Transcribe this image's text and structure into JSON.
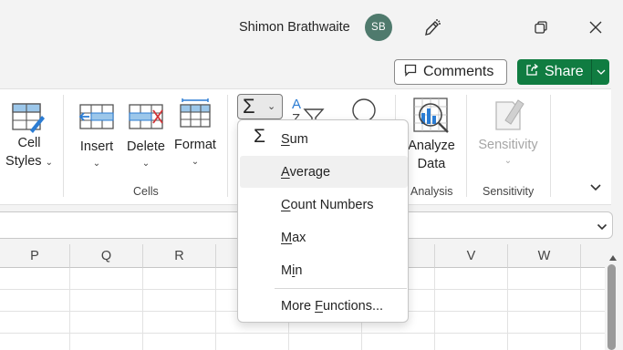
{
  "titlebar": {
    "user_name": "Shimon Brathwaite",
    "avatar_initials": "SB",
    "icons": [
      "designer-icon",
      "restore-window-icon",
      "close-window-icon"
    ]
  },
  "actions": {
    "comments_label": "Comments",
    "share_label": "Share"
  },
  "ribbon": {
    "cell_styles_line1": "Cell",
    "cell_styles_line2": "Styles",
    "insert_label": "Insert",
    "delete_label": "Delete",
    "format_label": "Format",
    "cells_group_label": "Cells",
    "analyze_line1": "Analyze",
    "analyze_line2": "Data",
    "analysis_group_label": "Analysis",
    "sensitivity_label": "Sensitivity",
    "sensitivity_group_label": "Sensitivity"
  },
  "autosum_menu": {
    "sum_prefix": "S",
    "sum_rest": "um",
    "average_prefix": "A",
    "average_rest": "verage",
    "count_prefix": "C",
    "count_rest": "ount Numbers",
    "max_prefix": "M",
    "max_rest": "ax",
    "min_a": "M",
    "min_b": "i",
    "min_c": "n",
    "more_a": "More ",
    "more_b": "F",
    "more_c": "unctions..."
  },
  "grid": {
    "columns": [
      "P",
      "Q",
      "R",
      "V",
      "W"
    ]
  },
  "colors": {
    "share_green": "#107c41",
    "avatar": "#4f7a6d"
  }
}
